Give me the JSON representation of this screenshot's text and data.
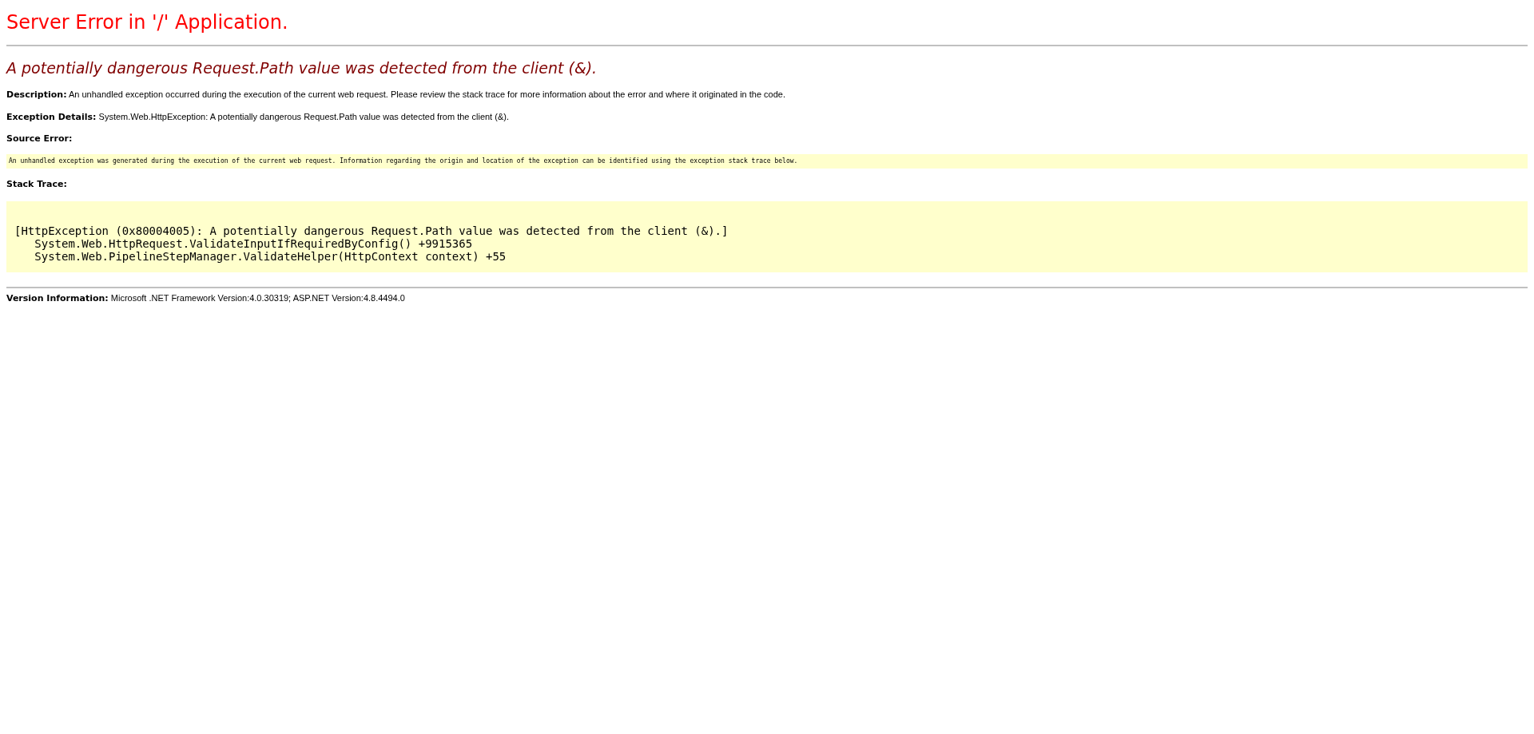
{
  "title": "Server Error in '/' Application.",
  "error_heading": "A potentially dangerous Request.Path value was detected from the client (&).",
  "details": [
    "**Description:** An unhandled exception occurred during the execution of the current web request. Please review the stack trace for more information about the error and where it originated in the code.",
    "**Exception Details:** System.Web.HttpException: A potentially dangerous Request.Path value was detected from the client (&)."
  ],
  "source_error": {
    "label": "Source Error:",
    "text": "An unhandled exception was generated during the execution of the current web request. Information regarding the origin and location of the exception can be identified using the exception stack trace below."
  },
  "stack_trace": {
    "label": "Stack Trace:",
    "lines": [
      "[HttpException (0x80004005): A potentially dangerous Request.Path value was detected from the client (&).]",
      "   System.Web.HttpRequest.ValidateInputIfRequiredByConfig() +9915365",
      "   System.Web.PipelineStepManager.ValidateHelper(HttpContext context) +55"
    ]
  },
  "version": "**Version Information:** Microsoft .NET Framework Version:4.0.30319; ASP.NET Version:4.8.4494.0"
}
